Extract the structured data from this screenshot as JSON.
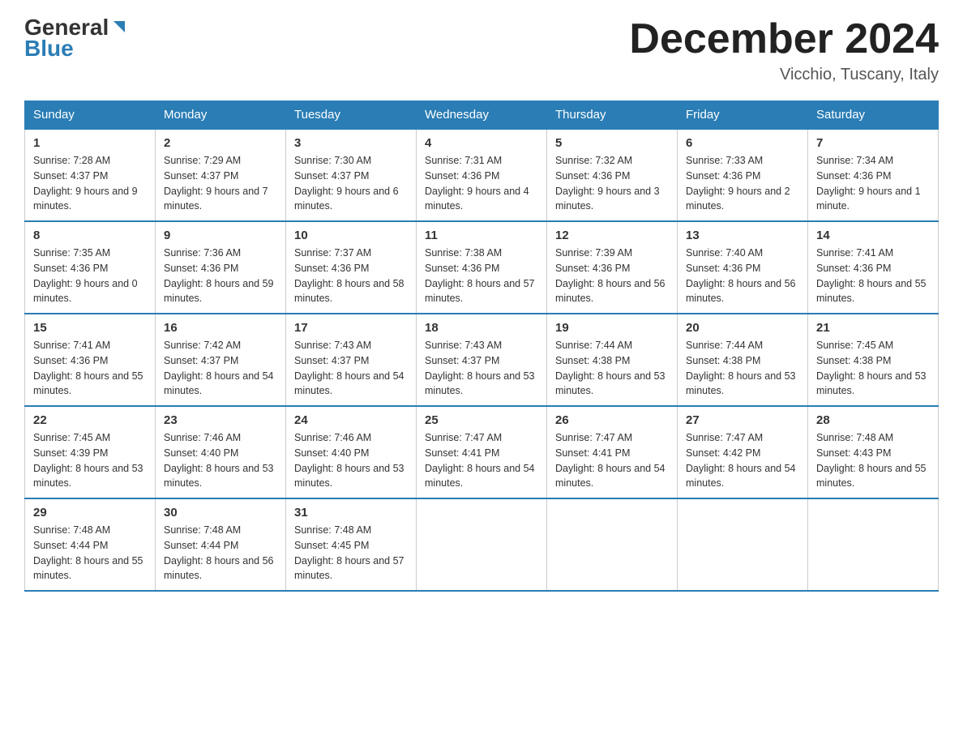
{
  "header": {
    "logo_general": "General",
    "logo_blue": "Blue",
    "month_title": "December 2024",
    "subtitle": "Vicchio, Tuscany, Italy"
  },
  "days_of_week": [
    "Sunday",
    "Monday",
    "Tuesday",
    "Wednesday",
    "Thursday",
    "Friday",
    "Saturday"
  ],
  "weeks": [
    [
      {
        "day": "1",
        "sunrise": "7:28 AM",
        "sunset": "4:37 PM",
        "daylight": "9 hours and 9 minutes."
      },
      {
        "day": "2",
        "sunrise": "7:29 AM",
        "sunset": "4:37 PM",
        "daylight": "9 hours and 7 minutes."
      },
      {
        "day": "3",
        "sunrise": "7:30 AM",
        "sunset": "4:37 PM",
        "daylight": "9 hours and 6 minutes."
      },
      {
        "day": "4",
        "sunrise": "7:31 AM",
        "sunset": "4:36 PM",
        "daylight": "9 hours and 4 minutes."
      },
      {
        "day": "5",
        "sunrise": "7:32 AM",
        "sunset": "4:36 PM",
        "daylight": "9 hours and 3 minutes."
      },
      {
        "day": "6",
        "sunrise": "7:33 AM",
        "sunset": "4:36 PM",
        "daylight": "9 hours and 2 minutes."
      },
      {
        "day": "7",
        "sunrise": "7:34 AM",
        "sunset": "4:36 PM",
        "daylight": "9 hours and 1 minute."
      }
    ],
    [
      {
        "day": "8",
        "sunrise": "7:35 AM",
        "sunset": "4:36 PM",
        "daylight": "9 hours and 0 minutes."
      },
      {
        "day": "9",
        "sunrise": "7:36 AM",
        "sunset": "4:36 PM",
        "daylight": "8 hours and 59 minutes."
      },
      {
        "day": "10",
        "sunrise": "7:37 AM",
        "sunset": "4:36 PM",
        "daylight": "8 hours and 58 minutes."
      },
      {
        "day": "11",
        "sunrise": "7:38 AM",
        "sunset": "4:36 PM",
        "daylight": "8 hours and 57 minutes."
      },
      {
        "day": "12",
        "sunrise": "7:39 AM",
        "sunset": "4:36 PM",
        "daylight": "8 hours and 56 minutes."
      },
      {
        "day": "13",
        "sunrise": "7:40 AM",
        "sunset": "4:36 PM",
        "daylight": "8 hours and 56 minutes."
      },
      {
        "day": "14",
        "sunrise": "7:41 AM",
        "sunset": "4:36 PM",
        "daylight": "8 hours and 55 minutes."
      }
    ],
    [
      {
        "day": "15",
        "sunrise": "7:41 AM",
        "sunset": "4:36 PM",
        "daylight": "8 hours and 55 minutes."
      },
      {
        "day": "16",
        "sunrise": "7:42 AM",
        "sunset": "4:37 PM",
        "daylight": "8 hours and 54 minutes."
      },
      {
        "day": "17",
        "sunrise": "7:43 AM",
        "sunset": "4:37 PM",
        "daylight": "8 hours and 54 minutes."
      },
      {
        "day": "18",
        "sunrise": "7:43 AM",
        "sunset": "4:37 PM",
        "daylight": "8 hours and 53 minutes."
      },
      {
        "day": "19",
        "sunrise": "7:44 AM",
        "sunset": "4:38 PM",
        "daylight": "8 hours and 53 minutes."
      },
      {
        "day": "20",
        "sunrise": "7:44 AM",
        "sunset": "4:38 PM",
        "daylight": "8 hours and 53 minutes."
      },
      {
        "day": "21",
        "sunrise": "7:45 AM",
        "sunset": "4:38 PM",
        "daylight": "8 hours and 53 minutes."
      }
    ],
    [
      {
        "day": "22",
        "sunrise": "7:45 AM",
        "sunset": "4:39 PM",
        "daylight": "8 hours and 53 minutes."
      },
      {
        "day": "23",
        "sunrise": "7:46 AM",
        "sunset": "4:40 PM",
        "daylight": "8 hours and 53 minutes."
      },
      {
        "day": "24",
        "sunrise": "7:46 AM",
        "sunset": "4:40 PM",
        "daylight": "8 hours and 53 minutes."
      },
      {
        "day": "25",
        "sunrise": "7:47 AM",
        "sunset": "4:41 PM",
        "daylight": "8 hours and 54 minutes."
      },
      {
        "day": "26",
        "sunrise": "7:47 AM",
        "sunset": "4:41 PM",
        "daylight": "8 hours and 54 minutes."
      },
      {
        "day": "27",
        "sunrise": "7:47 AM",
        "sunset": "4:42 PM",
        "daylight": "8 hours and 54 minutes."
      },
      {
        "day": "28",
        "sunrise": "7:48 AM",
        "sunset": "4:43 PM",
        "daylight": "8 hours and 55 minutes."
      }
    ],
    [
      {
        "day": "29",
        "sunrise": "7:48 AM",
        "sunset": "4:44 PM",
        "daylight": "8 hours and 55 minutes."
      },
      {
        "day": "30",
        "sunrise": "7:48 AM",
        "sunset": "4:44 PM",
        "daylight": "8 hours and 56 minutes."
      },
      {
        "day": "31",
        "sunrise": "7:48 AM",
        "sunset": "4:45 PM",
        "daylight": "8 hours and 57 minutes."
      },
      null,
      null,
      null,
      null
    ]
  ]
}
